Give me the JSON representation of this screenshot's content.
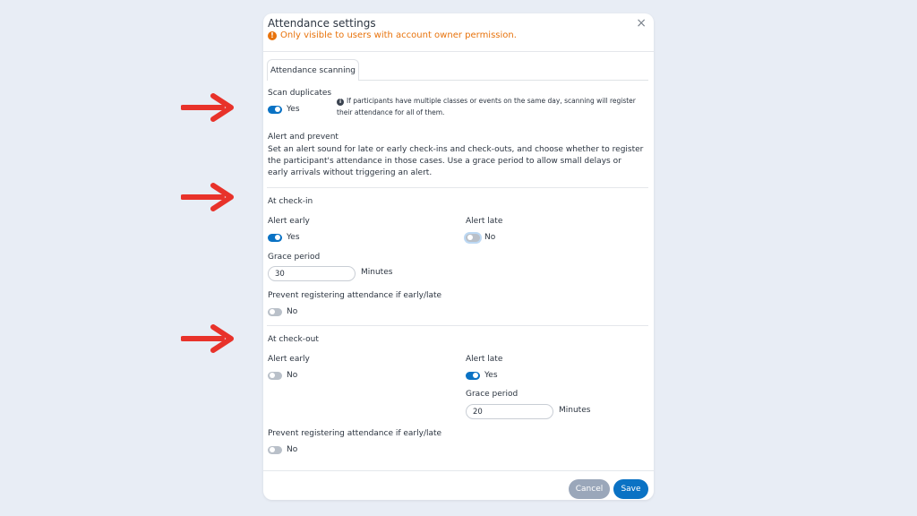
{
  "modal": {
    "title": "Attendance settings",
    "close_glyph": "×",
    "notice": "Only visible to users with account owner permission.",
    "notice_icon": "!"
  },
  "tabs": [
    {
      "label": "Attendance scanning"
    }
  ],
  "scan_duplicates": {
    "label": "Scan duplicates",
    "toggle_value": "Yes",
    "info_icon": "i",
    "info": "If participants have multiple classes or events on the same day, scanning will register their attendance for all of them."
  },
  "alert_prevent": {
    "title": "Alert and prevent",
    "description": "Set an alert sound for late or early check-ins and check-outs, and choose whether to register the participant's attendance in those cases. Use a grace period to allow small delays or early arrivals without triggering an alert."
  },
  "check_in": {
    "title": "At check-in",
    "alert_early_label": "Alert early",
    "alert_early_value": "Yes",
    "alert_late_label": "Alert late",
    "alert_late_value": "No",
    "grace_label": "Grace period",
    "grace_value": "30",
    "grace_unit": "Minutes",
    "prevent_label": "Prevent registering attendance if early/late",
    "prevent_value": "No"
  },
  "check_out": {
    "title": "At check-out",
    "alert_early_label": "Alert early",
    "alert_early_value": "No",
    "alert_late_label": "Alert late",
    "alert_late_value": "Yes",
    "grace_label": "Grace period",
    "grace_value": "20",
    "grace_unit": "Minutes",
    "prevent_label": "Prevent registering attendance if early/late",
    "prevent_value": "No"
  },
  "footer": {
    "cancel": "Cancel",
    "save": "Save"
  },
  "colors": {
    "accent": "#0a72c4",
    "warning": "#e8730c",
    "arrow": "#e8322a",
    "background": "#e8edf5"
  }
}
